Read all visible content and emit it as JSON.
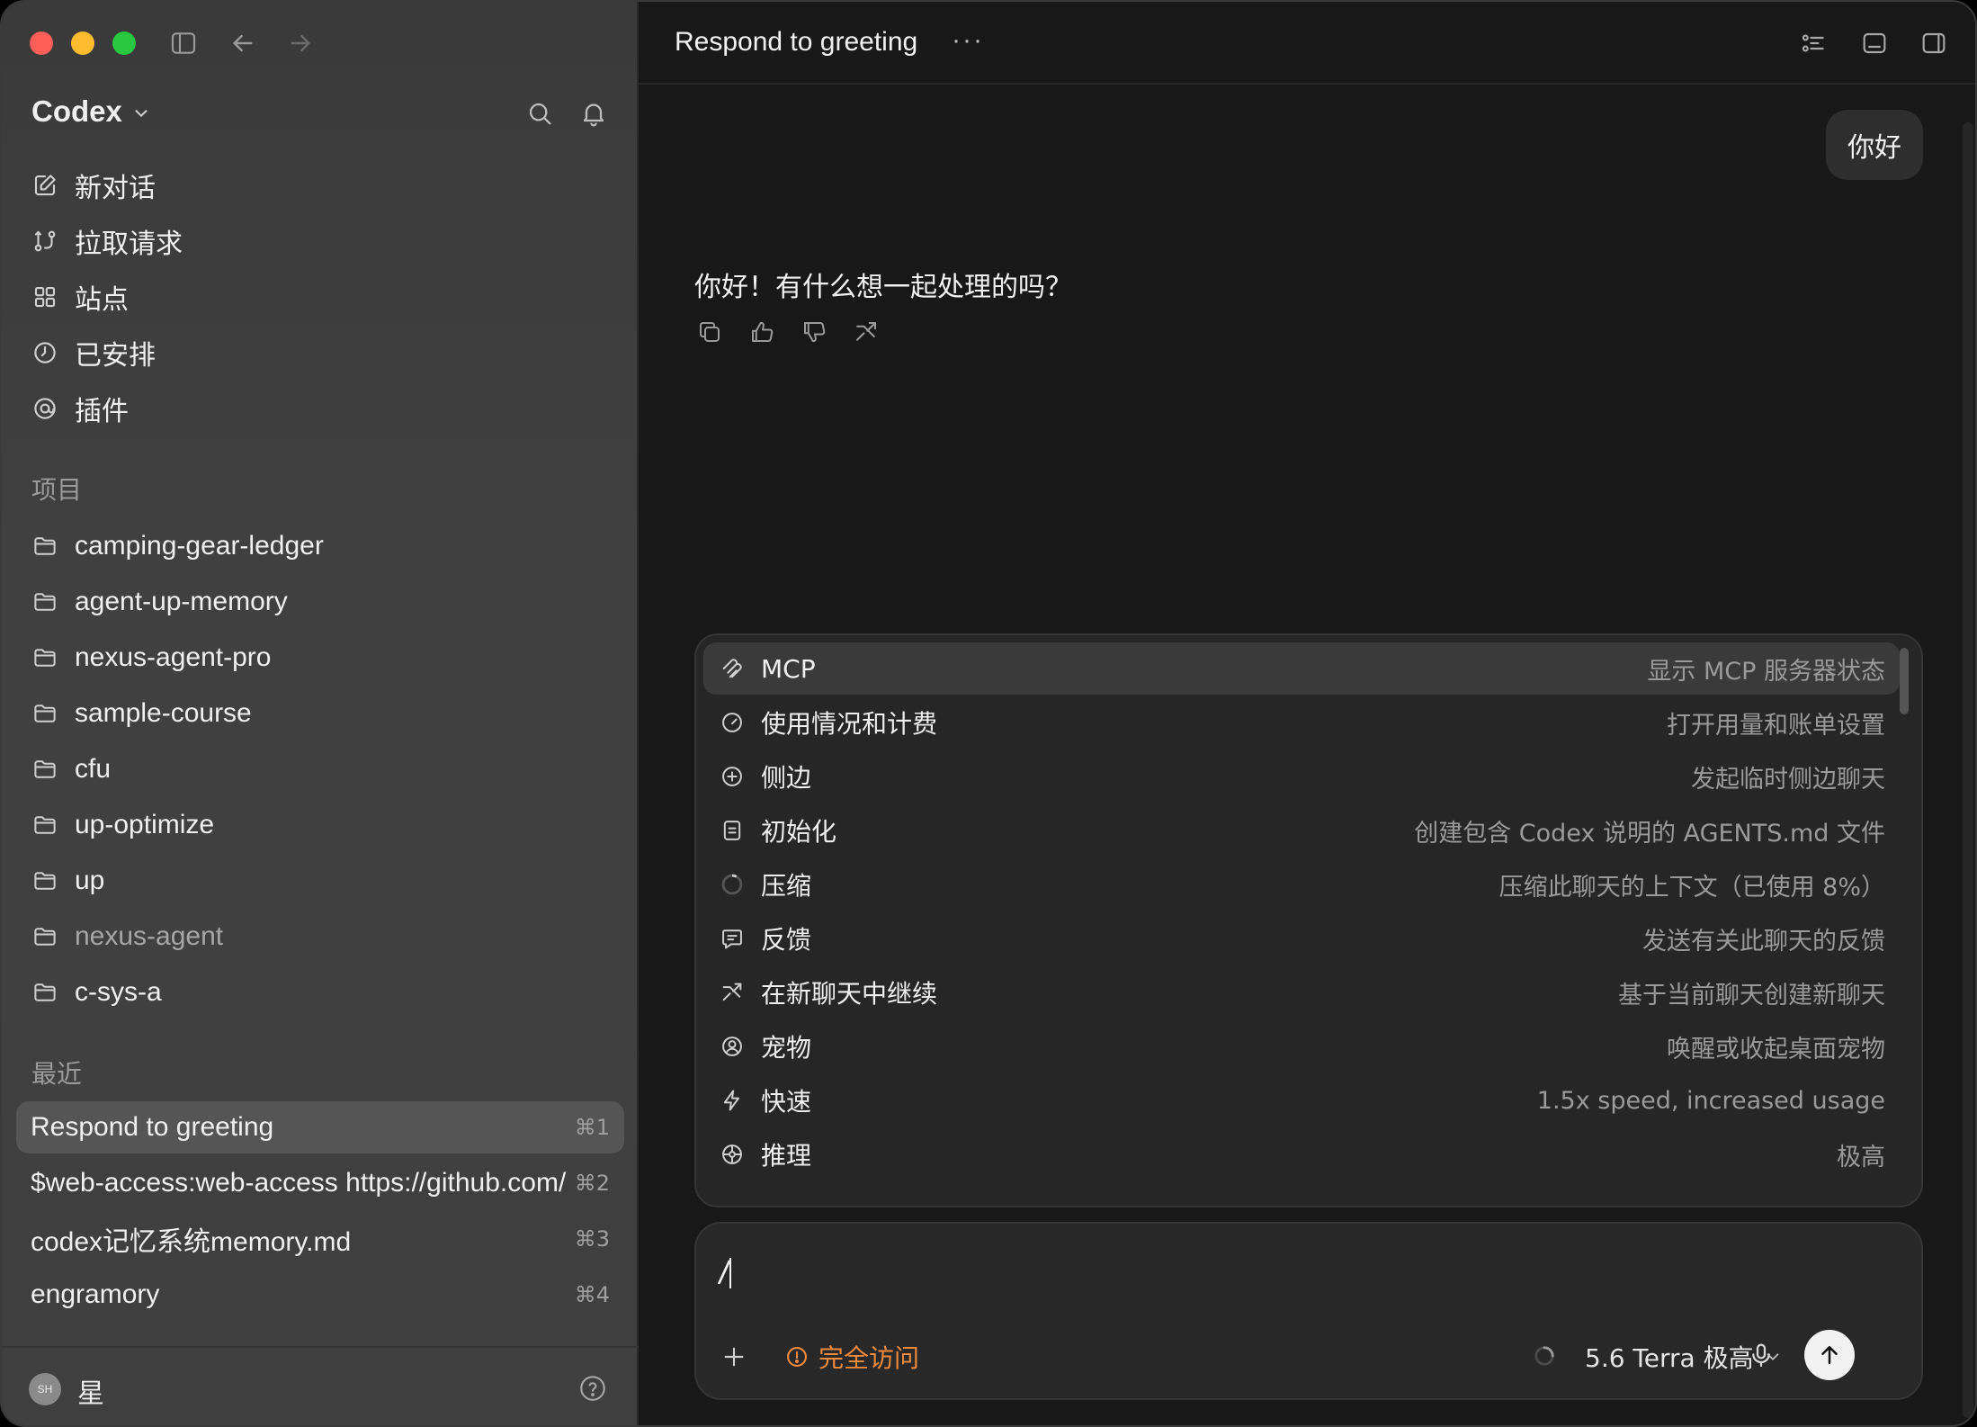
{
  "sidebar": {
    "app_name": "Codex",
    "nav": [
      {
        "label": "新对话",
        "icon": "edit-icon"
      },
      {
        "label": "拉取请求",
        "icon": "pull-request-icon"
      },
      {
        "label": "站点",
        "icon": "grid-icon"
      },
      {
        "label": "已安排",
        "icon": "clock-icon"
      },
      {
        "label": "插件",
        "icon": "plugin-icon"
      }
    ],
    "projects_title": "项目",
    "projects": [
      "camping-gear-ledger",
      "agent-up-memory",
      "nexus-agent-pro",
      "sample-course",
      "cfu",
      "up-optimize",
      "up",
      "nexus-agent",
      "c-sys-a"
    ],
    "recent_title": "最近",
    "recent": [
      {
        "title": "Respond to greeting",
        "shortcut": "⌘1"
      },
      {
        "title": "$web-access:web-access https://github.com/",
        "shortcut": "⌘2"
      },
      {
        "title": "codex记忆系统memory.md",
        "shortcut": "⌘3"
      },
      {
        "title": "engramory",
        "shortcut": "⌘4"
      }
    ],
    "user": {
      "initials": "SH",
      "name": "星"
    }
  },
  "header": {
    "title": "Respond to greeting",
    "more": "···"
  },
  "conversation": {
    "user_message": "你好",
    "assistant_message": "你好！有什么想一起处理的吗？"
  },
  "commands": [
    {
      "name": "MCP",
      "desc": "显示 MCP 服务器状态",
      "icon": "mcp-icon"
    },
    {
      "name": "使用情况和计费",
      "desc": "打开用量和账单设置",
      "icon": "gauge-icon"
    },
    {
      "name": "侧边",
      "desc": "发起临时侧边聊天",
      "icon": "plus-circle-icon"
    },
    {
      "name": "初始化",
      "desc": "创建包含 Codex 说明的 AGENTS.md 文件",
      "icon": "document-icon"
    },
    {
      "name": "压缩",
      "desc": "压缩此聊天的上下文（已使用 8%）",
      "icon": "progress-ring-icon"
    },
    {
      "name": "反馈",
      "desc": "发送有关此聊天的反馈",
      "icon": "feedback-icon"
    },
    {
      "name": "在新聊天中继续",
      "desc": "基于当前聊天创建新聊天",
      "icon": "fork-icon"
    },
    {
      "name": "宠物",
      "desc": "唤醒或收起桌面宠物",
      "icon": "pet-icon"
    },
    {
      "name": "快速",
      "desc": "1.5x speed, increased usage",
      "icon": "bolt-icon"
    },
    {
      "name": "推理",
      "desc": "极高",
      "icon": "brain-icon"
    }
  ],
  "composer": {
    "input_value": "/",
    "access_label": "完全访问",
    "model_label": "5.6 Terra 极高"
  },
  "colors": {
    "accent_orange": "#f08a3c",
    "sidebar_bg": "#3f3f3f",
    "main_bg": "#181818"
  }
}
